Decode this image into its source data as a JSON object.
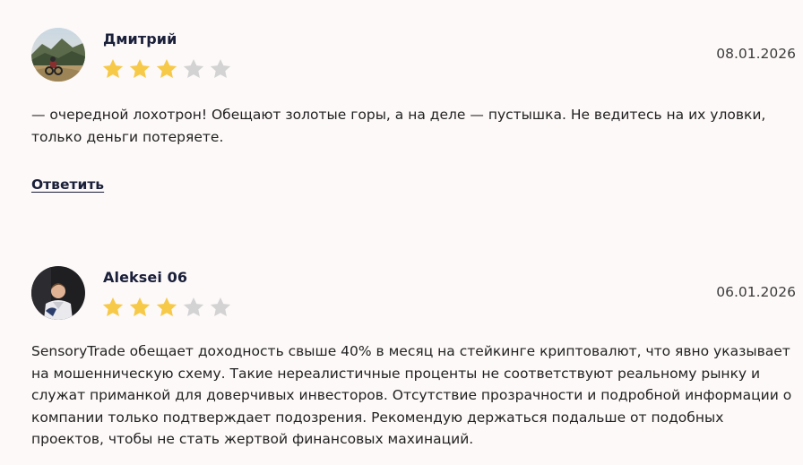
{
  "reviews": [
    {
      "author": "Дмитрий",
      "date": "08.01.2026",
      "rating": 3,
      "max_rating": 5,
      "text": "— очередной лохотрон! Обещают золотые горы, а на деле — пустышка. Не ведитесь на их уловки, только деньги потеряете.",
      "reply_label": "Ответить"
    },
    {
      "author": "Aleksei 06",
      "date": "06.01.2026",
      "rating": 3,
      "max_rating": 5,
      "text": "SensoryTrade обещает доходность свыше 40% в месяц на стейкинге криптовалют, что явно указывает на мошенническую схему. Такие нереалистичные проценты не соответствуют реальному рынку и служат приманкой для доверчивых инвесторов. Отсутствие прозрачности и подробной информации о компании только подтверждает подозрения. Рекомендую держаться подальше от подобных проектов, чтобы не стать жертвой финансовых махинаций."
    }
  ],
  "colors": {
    "star_filled": "#f7c948",
    "star_empty": "#d3d3d3",
    "author": "#1a1f3a",
    "background": "#fdf9f8"
  },
  "icons": {
    "star": "star-icon"
  }
}
